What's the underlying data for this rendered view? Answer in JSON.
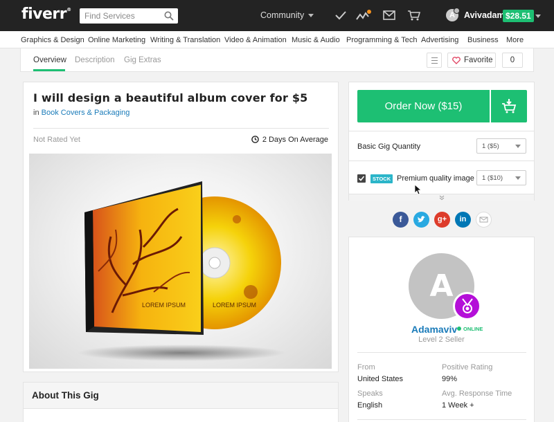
{
  "header": {
    "logo": "fiverr",
    "logo_mark": "®",
    "search_placeholder": "Find Services",
    "community_label": "Community",
    "username": "Avivadam",
    "avatar_initial": "A",
    "balance": "$28.51"
  },
  "categories": [
    "Graphics & Design",
    "Online Marketing",
    "Writing & Translation",
    "Video & Animation",
    "Music & Audio",
    "Programming & Tech",
    "Advertising",
    "Business",
    "More"
  ],
  "subnav": {
    "tabs": [
      "Overview",
      "Description",
      "Gig Extras"
    ],
    "active_tab": "Overview",
    "favorite_label": "Favorite",
    "favorite_count": "0"
  },
  "gig": {
    "title": "I will design a beautiful album cover for $5",
    "category_prefix": "in",
    "category": "Book Covers & Packaging",
    "rating": "Not Rated Yet",
    "delivery": "2 Days On Average",
    "image_text_left": "LOREM IPSUM",
    "image_text_disc": "LOREM IPSUM"
  },
  "about": {
    "heading": "About This Gig"
  },
  "order": {
    "button_label": "Order Now ($15)",
    "quantity_label": "Basic Gig Quantity",
    "quantity_value": "1 ($5)",
    "extra_badge": "STOCK",
    "extra_label": "Premium quality image",
    "extra_value": "1 ($10)",
    "extra_checked": true
  },
  "social": [
    "facebook",
    "twitter",
    "google-plus",
    "linkedin",
    "email"
  ],
  "seller": {
    "avatar_initial": "A",
    "name": "Adamaviv",
    "status": "ONLINE",
    "level": "Level 2 Seller",
    "stats": [
      {
        "label": "From",
        "value": "United States"
      },
      {
        "label": "Positive Rating",
        "value": "99%"
      },
      {
        "label": "Speaks",
        "value": "English"
      },
      {
        "label": "Avg. Response Time",
        "value": "1 Week +"
      }
    ]
  },
  "colors": {
    "brand_green": "#1dbf73",
    "link_blue": "#1a7bb9",
    "badge_purple": "#b40fd8",
    "topbar": "#232323"
  }
}
